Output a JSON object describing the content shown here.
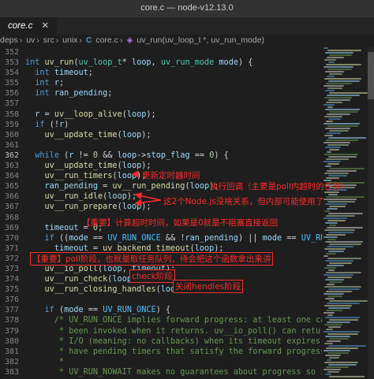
{
  "window": {
    "title": "core.c — node-v12.13.0"
  },
  "tab": {
    "label": "core.c"
  },
  "breadcrumb": [
    "deps",
    "uv",
    "src",
    "unix",
    "core.c",
    "uv_run(uv_loop_t *, uv_run_mode)"
  ],
  "line_numbers": [
    "352",
    "353",
    "354",
    "355",
    "356",
    "357",
    "358",
    "359",
    "360",
    "361",
    "362",
    "363",
    "364",
    "365",
    "366",
    "367",
    "368",
    "369",
    "370",
    "371",
    "372",
    "373",
    "374",
    "375",
    "376",
    "377",
    "378",
    "379",
    "380",
    "381",
    "382",
    "383"
  ],
  "code_lines": [
    "",
    "int uv_run(uv_loop_t* loop, uv_run_mode mode) {",
    "  int timeout;",
    "  int r;",
    "  int ran_pending;",
    "",
    "  r = uv__loop_alive(loop);",
    "  if (!r)",
    "    uv__update_time(loop);",
    "",
    "  while (r != 0 && loop->stop_flag == 0) {",
    "    uv__update_time(loop);",
    "    uv__run_timers(loop);",
    "    ran_pending = uv__run_pending(loop);",
    "    uv__run_idle(loop);",
    "    uv__run_prepare(loop);",
    "",
    "    timeout = 0;",
    "    if ((mode == UV_RUN_ONCE && !ran_pending) || mode == UV_RUN_DEFAULT)",
    "      timeout = uv_backend_timeout(loop);",
    "",
    "    uv__io_poll(loop, timeout);",
    "    uv__run_check(loop);",
    "    uv__run_closing_handles(loop);",
    "",
    "    if (mode == UV_RUN_ONCE) {",
    "      /* UV_RUN_ONCE implies forward progress: at least one callback must have",
    "       * been invoked when it returns. uv__io_poll() can return without doing",
    "       * I/O (meaning: no callbacks) when its timeout expires - which means we",
    "       * have pending timers that satisfy the forward progress constraint.",
    "       *",
    "       * UV_RUN_NOWAIT makes no guarantees about progress so it's omitted from"
  ],
  "annotations": {
    "timers": "更新定时器时间",
    "pending": "执行回调（主要是poll内超时的任务）",
    "idle_prepare": "这2个Node.js没啥关系，但内部可能使用了",
    "timeout": "【重要】计算超时时间，如果是0就是不阻塞直接返回",
    "poll": "【重要】poll阶段，也就是取任务队列，待会把这个函数拿出来讲",
    "check": "check阶段",
    "closing": "关闭hendles阶段"
  },
  "colors": {
    "annotation": "#ff2a2a",
    "background": "#1e1e1e",
    "keyword": "#569cd6",
    "function": "#dcdcaa",
    "comment": "#6a9955"
  }
}
